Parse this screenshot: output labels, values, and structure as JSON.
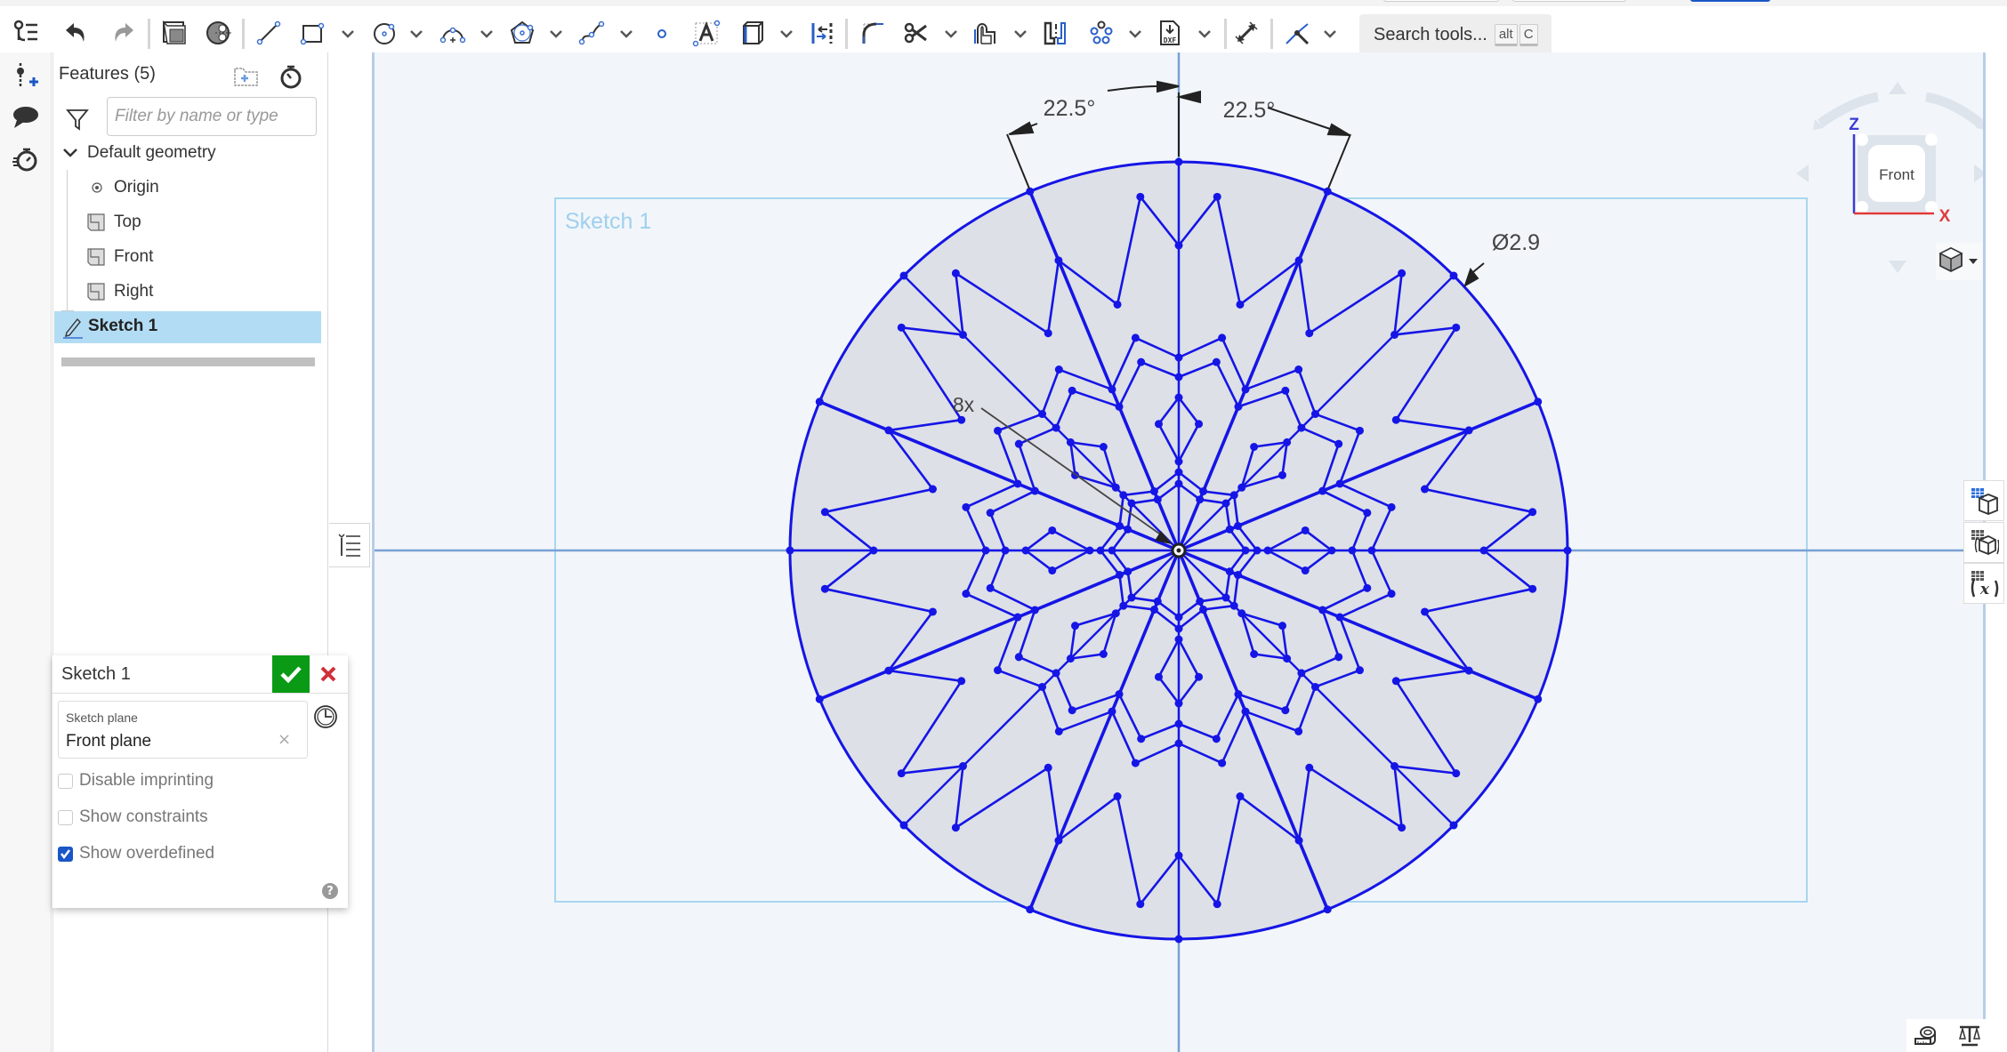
{
  "toolbar": {
    "tools": [
      {
        "name": "feature-list-toggle",
        "icon": "feature-tree-icon"
      },
      {
        "name": "undo",
        "icon": "undo-icon"
      },
      {
        "name": "redo",
        "icon": "redo-icon"
      },
      {
        "name": "plane",
        "icon": "plane-icon"
      },
      {
        "name": "section-view",
        "icon": "section-view-icon"
      },
      {
        "name": "line",
        "icon": "line-icon"
      },
      {
        "name": "rectangle",
        "icon": "rectangle-icon"
      },
      {
        "name": "circle",
        "icon": "circle-icon"
      },
      {
        "name": "arc",
        "icon": "arc-icon"
      },
      {
        "name": "polygon",
        "icon": "polygon-icon"
      },
      {
        "name": "spline",
        "icon": "spline-icon"
      },
      {
        "name": "point",
        "icon": "point-icon"
      },
      {
        "name": "text",
        "icon": "text-icon"
      },
      {
        "name": "construction-box",
        "icon": "box-icon"
      },
      {
        "name": "mirror",
        "icon": "mirror-icon"
      },
      {
        "name": "fillet",
        "icon": "fillet-icon"
      },
      {
        "name": "trim",
        "icon": "scissors-icon"
      },
      {
        "name": "offset",
        "icon": "offset-icon"
      },
      {
        "name": "use",
        "icon": "use-icon"
      },
      {
        "name": "pattern",
        "icon": "pattern-icon"
      },
      {
        "name": "dxf-import",
        "icon": "dxf-icon"
      },
      {
        "name": "dimension",
        "icon": "dimension-icon"
      },
      {
        "name": "construction",
        "icon": "construction-icon"
      }
    ],
    "search_label": "Search tools...",
    "search_key1": "alt",
    "search_key2": "C"
  },
  "features_panel": {
    "title": "Features (5)",
    "filter_placeholder": "Filter by name or type",
    "group_label": "Default geometry",
    "items": [
      {
        "label": "Origin",
        "type": "origin"
      },
      {
        "label": "Top",
        "type": "plane"
      },
      {
        "label": "Front",
        "type": "plane"
      },
      {
        "label": "Right",
        "type": "plane"
      }
    ],
    "selected_item": "Sketch 1"
  },
  "sketch_dialog": {
    "title": "Sketch 1",
    "plane_label": "Sketch plane",
    "plane_value": "Front plane",
    "options": [
      {
        "label": "Disable imprinting",
        "checked": false
      },
      {
        "label": "Show constraints",
        "checked": false
      },
      {
        "label": "Show overdefined",
        "checked": true
      }
    ],
    "help": "?"
  },
  "viewport": {
    "sketch_label": "Sketch 1",
    "view_cube_label": "Front",
    "axis_z": "Z",
    "axis_x": "X",
    "dimensions": {
      "angle_left": "22.5°",
      "angle_right": "22.5°",
      "diameter": "Ø2.9",
      "pattern_count": "8x"
    },
    "colors": {
      "sketch_line": "#1515e6",
      "sketch_fill": "#dde0e6",
      "canvas_bg": "#f2f6fa",
      "sketch_box": "#a8d6f0",
      "axis_z": "#3b3bd6",
      "axis_x": "#e03a3a",
      "confirm": "#0a9a16",
      "cancel": "#d0303a",
      "selection": "#b2dcf3"
    }
  }
}
